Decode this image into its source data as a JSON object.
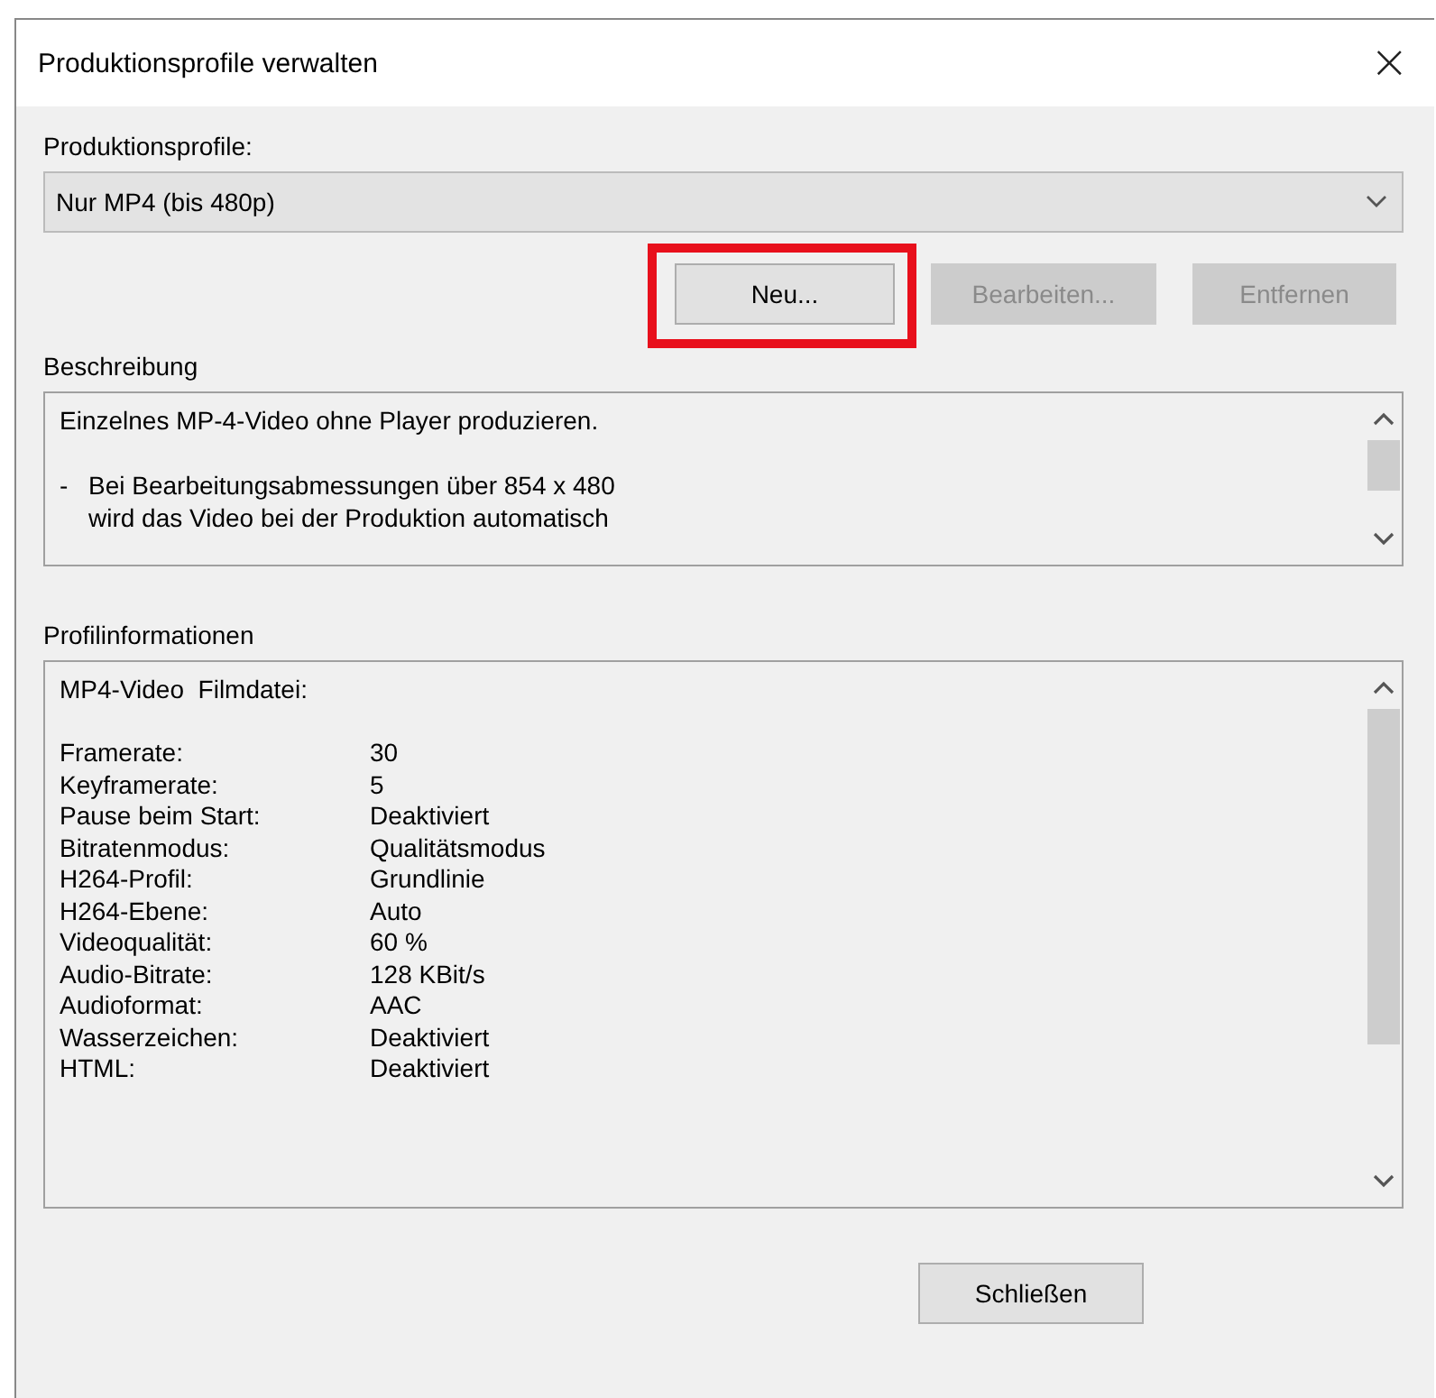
{
  "window": {
    "title": "Produktionsprofile verwalten",
    "close": "×"
  },
  "profile_label": "Produktionsprofile:",
  "profile_select": {
    "value": "Nur MP4 (bis 480p)"
  },
  "buttons": [
    {
      "label": "Neu...",
      "disabled": false,
      "highlighted": true
    },
    {
      "label": "Bearbeiten...",
      "disabled": true,
      "highlighted": false
    },
    {
      "label": "Entfernen",
      "disabled": true,
      "highlighted": false
    }
  ],
  "description": {
    "label": "Beschreibung",
    "intro": "Einzelnes MP-4-Video ohne Player produzieren.",
    "bullet": {
      "mark": "-",
      "lines": [
        "Bei Bearbeitungsabmessungen über 854 x 480",
        "wird das Video bei der Produktion automatisch"
      ]
    }
  },
  "profile_info": {
    "label": "Profilinformationen",
    "heading": "MP4-Video  Filmdatei:",
    "rows": [
      {
        "name": "Framerate:",
        "value": "30"
      },
      {
        "name": "Keyframerate:",
        "value": "5"
      },
      {
        "name": "Pause beim Start:",
        "value": "Deaktiviert"
      },
      {
        "name": "Bitratenmodus:",
        "value": "Qualitätsmodus"
      },
      {
        "name": "H264-Profil:",
        "value": "Grundlinie"
      },
      {
        "name": "H264-Ebene:",
        "value": "Auto"
      },
      {
        "name": "Videoqualität:",
        "value": "60 %"
      },
      {
        "name": "Audio-Bitrate:",
        "value": "128 KBit/s"
      },
      {
        "name": "Audioformat:",
        "value": "AAC"
      },
      {
        "name": "Wasserzeichen:",
        "value": "Deaktiviert"
      },
      {
        "name": "HTML:",
        "value": "Deaktiviert"
      }
    ]
  },
  "close_button": "Schließen"
}
